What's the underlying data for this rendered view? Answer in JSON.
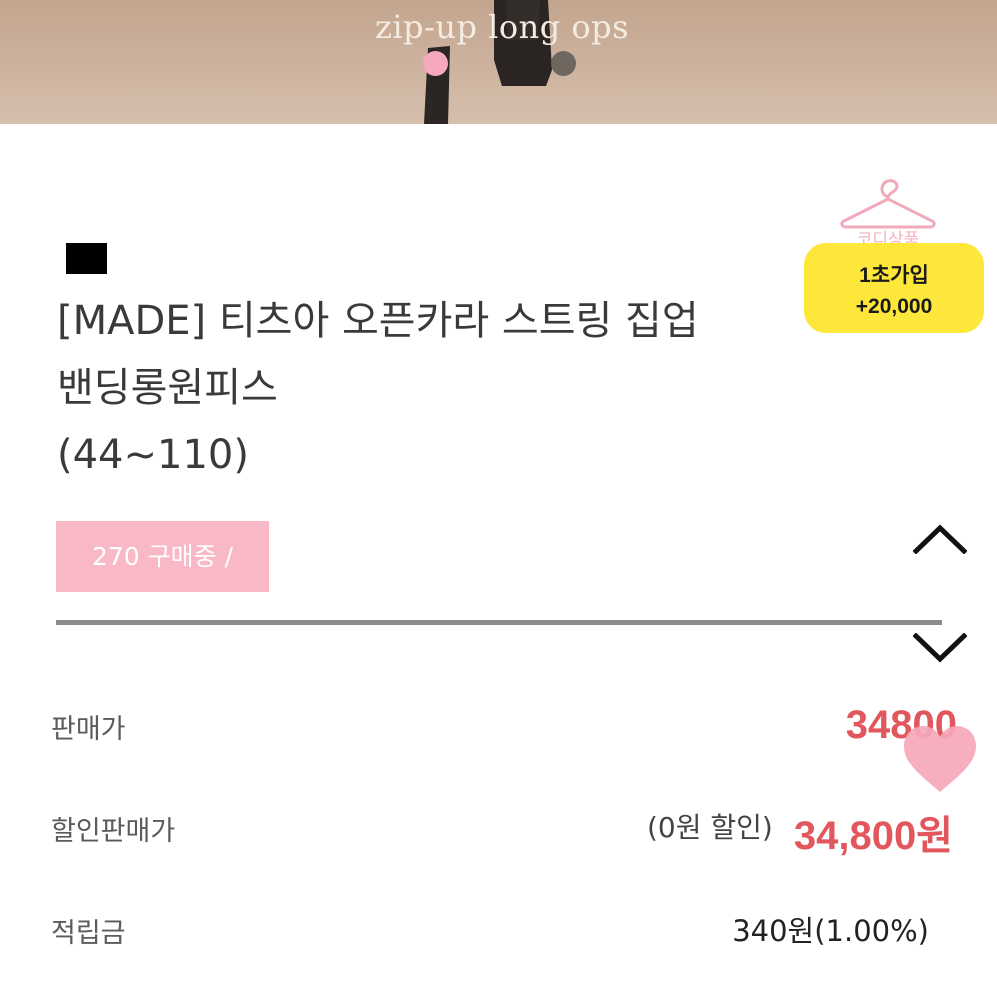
{
  "banner": {
    "caption": "zip-up long ops",
    "indicator_count": 2,
    "active_index": 0
  },
  "coordi": {
    "label": "코디상품",
    "icon": "hanger-icon"
  },
  "promo": {
    "line1": "1초가입",
    "line2": "+20,000"
  },
  "product": {
    "color_swatch": "#000000",
    "title_lines": [
      "[MADE] 티츠아 오픈카라 스트링 집업",
      "밴딩롱원피스",
      "(44~110)"
    ],
    "buying_badge": "270 구매중 /"
  },
  "price_rows": {
    "price_label": "판매가",
    "price_value": "34800",
    "sale_label": "할인판매가",
    "discount_note": "(0원 할인)",
    "sale_value": "34,800원",
    "points_label": "적립금",
    "points_value": "340원(1.00%)"
  },
  "colors": {
    "accent_pink": "#f8b8c5",
    "price_red": "#e2575e",
    "promo_yellow": "#fde73a"
  },
  "icons": {
    "scroll_up": "chevron-up-icon",
    "scroll_down": "chevron-down-icon",
    "wishlist": "heart-icon"
  }
}
